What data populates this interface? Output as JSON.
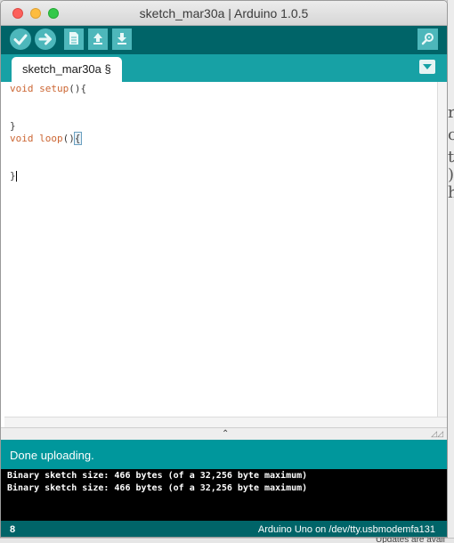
{
  "window": {
    "title": "sketch_mar30a | Arduino 1.0.5"
  },
  "toolbar": {
    "verify_icon": "checkmark-icon",
    "upload_icon": "right-arrow-icon",
    "new_icon": "document-icon",
    "open_icon": "up-arrow-icon",
    "save_icon": "down-arrow-icon",
    "serial_monitor_icon": "magnifier-icon"
  },
  "tabs": [
    {
      "label": "sketch_mar30a §"
    }
  ],
  "editor": {
    "lines": [
      {
        "kw": "void",
        "fn": "setup",
        "rest": "(){"
      },
      {
        "text": ""
      },
      {
        "text": ""
      },
      {
        "text": "}"
      },
      {
        "kw": "void",
        "fn": "loop",
        "rest_before": "()",
        "brace": "{"
      },
      {
        "text": ""
      },
      {
        "text": ""
      },
      {
        "text": "}"
      }
    ]
  },
  "status": {
    "message": "Done uploading."
  },
  "console": {
    "lines": [
      "Binary sketch size: 466 bytes (of a 32,256 byte maximum)",
      "Binary sketch size: 466 bytes (of a 32,256 byte maximum)"
    ]
  },
  "footer": {
    "line_number": "8",
    "board": "Arduino Uno on /dev/tty.usbmodemfa131"
  },
  "background": {
    "glyphs": [
      "r",
      "c",
      "t",
      ")",
      "h"
    ],
    "bottom_text": "Updates are avail"
  },
  "colors": {
    "toolbar": "#006468",
    "tab_bar": "#17a1a5",
    "status": "#00979c",
    "button": "#4db7bb"
  }
}
